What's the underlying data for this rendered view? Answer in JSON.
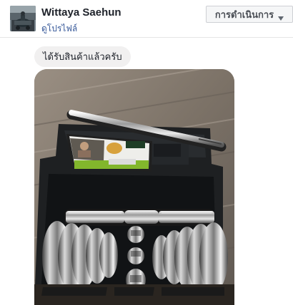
{
  "header": {
    "user_name": "Wittaya Saehun",
    "profile_link": "ดูโปรไฟล์",
    "actions_button": "การดำเนินการ"
  },
  "conversation": {
    "messages": [
      {
        "type": "text",
        "text": "ได้รับสินค้าแล้วครับ"
      },
      {
        "type": "photo",
        "subject": "dumbbell set in black carrying case"
      }
    ]
  },
  "colors": {
    "link_blue": "#365899",
    "bubble_gray": "#f1f0f0",
    "button_bg": "#f5f6f7",
    "accent_rail": "#4267b2"
  },
  "icons": {
    "actions_dropdown": "chevron-down-icon",
    "photo": "dumbbell-set-photo"
  }
}
